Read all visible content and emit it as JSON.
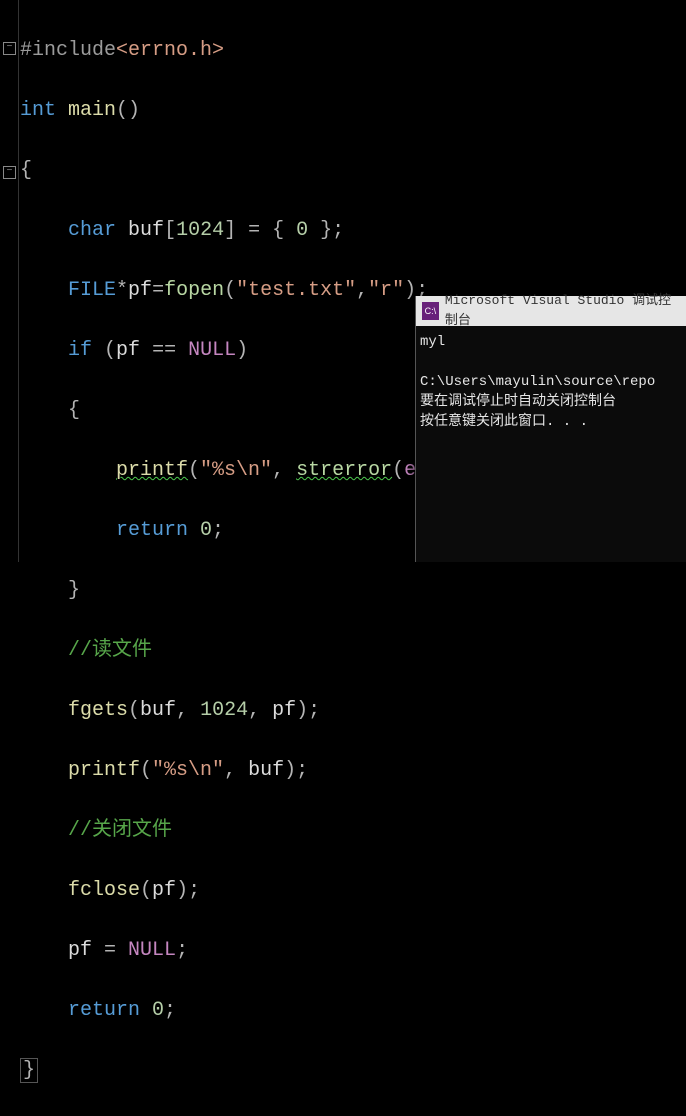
{
  "code": {
    "line1_pp": "#include",
    "line1_hdr": "<errno.h>",
    "line2_kw1": "int",
    "line2_fn": "main",
    "line2_paren": "()",
    "brace_open": "{",
    "line4_kw": "char",
    "line4_ident": "buf",
    "line4_arr_open": "[",
    "line4_size": "1024",
    "line4_arr_close": "]",
    "line4_eq": " = { ",
    "line4_zero": "0",
    "line4_close": " };",
    "line5_type": "FILE",
    "line5_star": "*",
    "line5_ident": "pf",
    "line5_eq": "=",
    "line5_fn": "fopen",
    "line5_open": "(",
    "line5_str1": "\"test.txt\"",
    "line5_comma": ",",
    "line5_str2": "\"r\"",
    "line5_close": ");",
    "line6_kw": "if",
    "line6_open": " (",
    "line6_pf": "pf",
    "line6_eq": " == ",
    "line6_null": "NULL",
    "line6_close": ")",
    "line7_brace": "{",
    "line8_fn": "printf",
    "line8_open": "(",
    "line8_str": "\"%s\\n\"",
    "line8_comma": ", ",
    "line8_strerr": "strerror",
    "line8_p2": "(",
    "line8_errno": "errno",
    "line8_close": "));",
    "line9_kw": "return",
    "line9_val": " 0",
    "line9_semi": ";",
    "line10_brace": "}",
    "line11_comment": "//读文件",
    "line12_fn": "fgets",
    "line12_open": "(",
    "line12_buf": "buf",
    "line12_c1": ", ",
    "line12_num": "1024",
    "line12_c2": ", ",
    "line12_pf": "pf",
    "line12_close": ");",
    "line13_fn": "printf",
    "line13_open": "(",
    "line13_str": "\"%s\\n\"",
    "line13_c": ", ",
    "line13_buf": "buf",
    "line13_close": ");",
    "line14_comment": "//关闭文件",
    "line15_fn": "fclose",
    "line15_open": "(",
    "line15_pf": "pf",
    "line15_close": ");",
    "line16_pf": "pf",
    "line16_eq": " = ",
    "line16_null": "NULL",
    "line16_semi": ";",
    "line17_kw": "return",
    "line17_val": " 0",
    "line17_semi": ";",
    "brace_close": "}"
  },
  "gutter": {
    "fold_minus": "−"
  },
  "console": {
    "title_icon": "C:\\",
    "title_text": "Microsoft Visual Studio 调试控制台",
    "output_line1": "myl",
    "output_blank": "",
    "output_line2": "C:\\Users\\mayulin\\source\\repo",
    "output_line3": "要在调试停止时自动关闭控制台",
    "output_line4": "按任意键关闭此窗口. . ."
  }
}
